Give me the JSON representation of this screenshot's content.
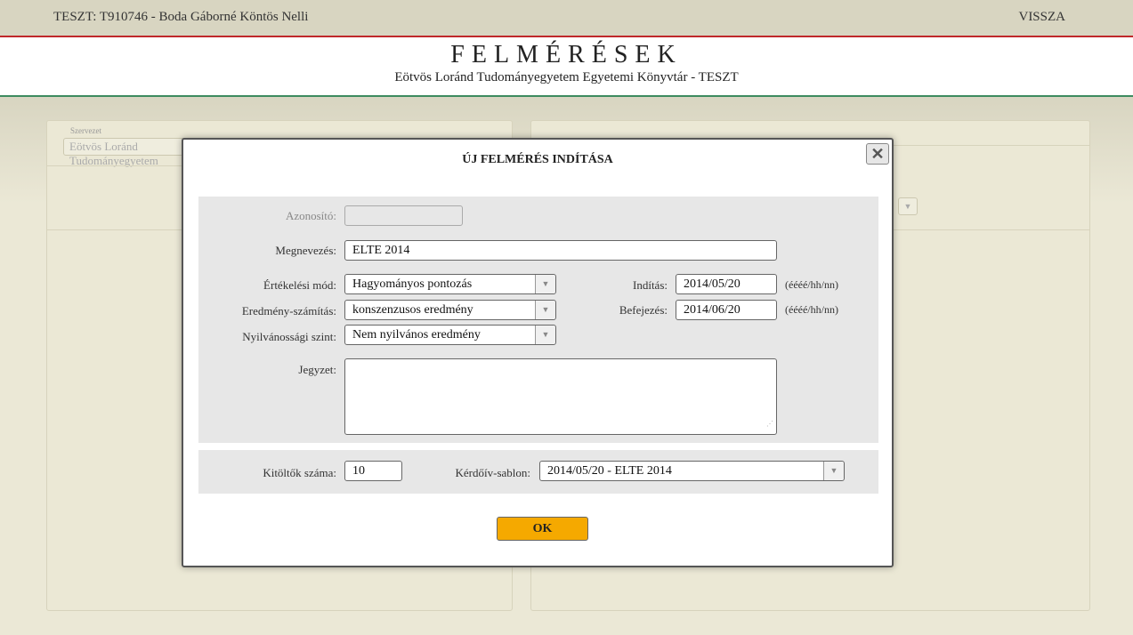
{
  "topbar": {
    "user": "TESZT: T910746 - Boda Gáborné Köntös Nelli",
    "back": "VISSZA"
  },
  "header": {
    "title": "FELMÉRÉSEK",
    "subtitle": "Eötvös Loránd Tudományegyetem Egyetemi Könyvtár - TESZT"
  },
  "background": {
    "org_label": "Szervezet",
    "org_value": "Eötvös Loránd Tudományegyetem"
  },
  "modal": {
    "title": "ÚJ FELMÉRÉS INDÍTÁSA",
    "close_icon": "close-icon",
    "fields": {
      "azonosito_label": "Azonosító:",
      "azonosito_value": "",
      "megnevezes_label": "Megnevezés:",
      "megnevezes_value": "ELTE 2014",
      "ertekelesi_label": "Értékelési mód:",
      "ertekelesi_value": "Hagyományos pontozás",
      "eredmeny_label": "Eredmény-számítás:",
      "eredmeny_value": "konszenzusos eredmény",
      "nyilvanossagi_label": "Nyilvánossági szint:",
      "nyilvanossagi_value": "Nem nyilvános eredmény",
      "inditas_label": "Indítás:",
      "inditas_value": "2014/05/20",
      "befejezes_label": "Befejezés:",
      "befejezes_value": "2014/06/20",
      "date_hint": "(éééé/hh/nn)",
      "jegyzet_label": "Jegyzet:",
      "jegyzet_value": "",
      "kitoltok_label": "Kitöltők száma:",
      "kitoltok_value": "10",
      "sablon_label": "Kérdőív-sablon:",
      "sablon_value": "2014/05/20 - ELTE 2014"
    },
    "ok_label": "OK"
  },
  "colors": {
    "accent": "#f5a900",
    "topbar_border": "#c0282a",
    "header_border": "#3d8b5f"
  }
}
